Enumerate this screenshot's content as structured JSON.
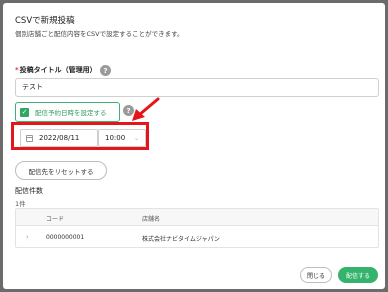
{
  "modal": {
    "title": "CSVで新規投稿",
    "subtitle": "個別店舗ごと配信内容をCSVで設定することができます。"
  },
  "post_title": {
    "required_mark": "*",
    "label": "投稿タイトル（管理用）",
    "help": "?",
    "value": "テスト"
  },
  "schedule": {
    "checkbox_label": "配信予約日時を設定する",
    "checked": true,
    "check_glyph": "✓",
    "help": "?",
    "date": "2022/08/11",
    "time": "10:00",
    "time_chevron": "⌄"
  },
  "reset_button": "配信先をリセットする",
  "delivery": {
    "count_label": "配信件数",
    "count_value": "1件"
  },
  "table": {
    "columns": [
      "コード",
      "店舗名"
    ],
    "rows": [
      {
        "expand": "›",
        "code": "0000000001",
        "store": "株式会社ナビタイムジャパン"
      }
    ]
  },
  "footer": {
    "close_label": "閉じる",
    "submit_label": "配信する"
  },
  "colors": {
    "accent_green": "#33b36b",
    "highlight_red": "#e5161b"
  }
}
